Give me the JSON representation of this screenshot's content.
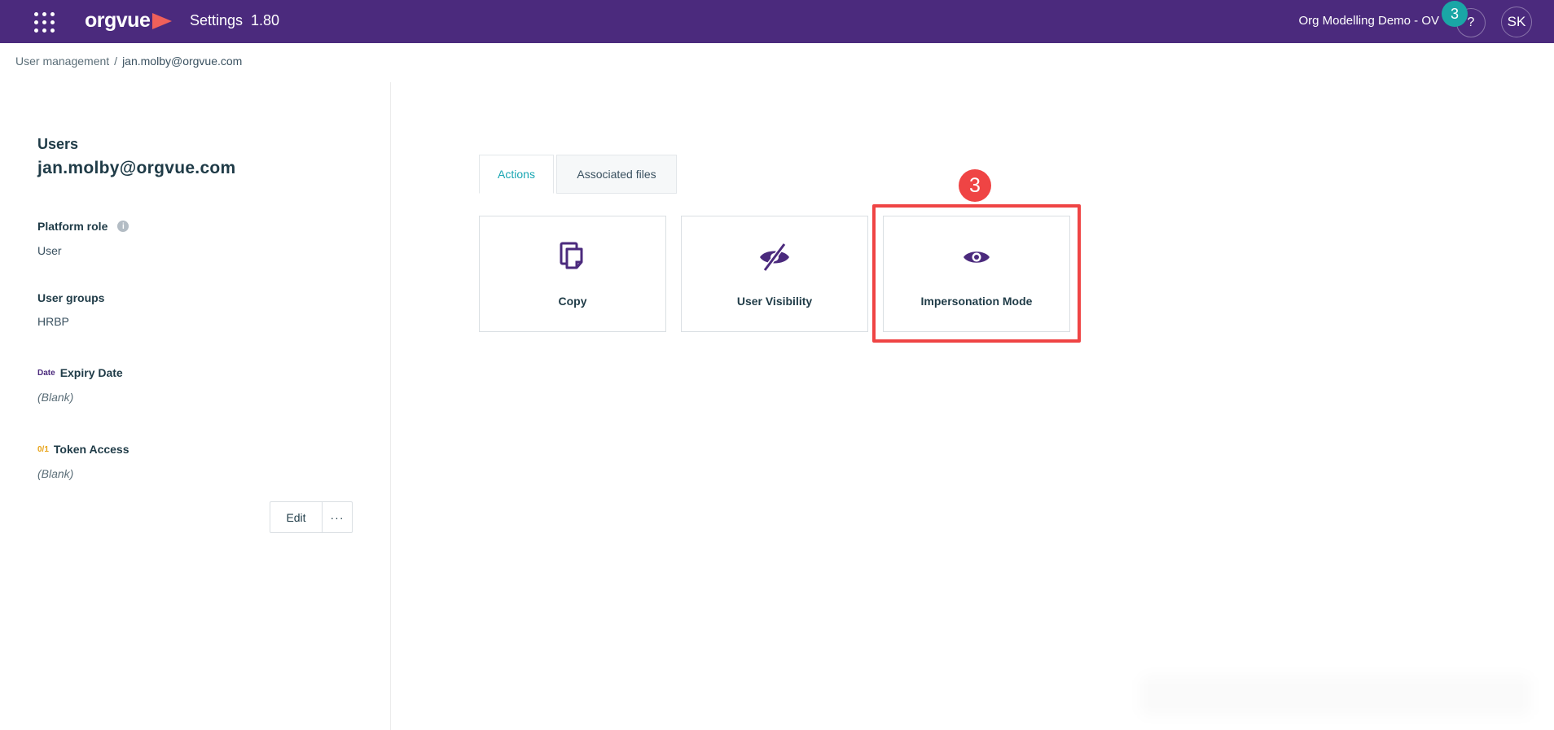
{
  "topbar": {
    "app_name": "Settings",
    "app_version": "1.80",
    "logo_text": "orgvue",
    "org_name": "Org Modelling Demo - OV",
    "help_label": "?",
    "help_badge": "3",
    "avatar_initials": "SK"
  },
  "breadcrumb": {
    "parent": "User management",
    "separator": "/",
    "current": "jan.molby@orgvue.com"
  },
  "user": {
    "heading": "Users",
    "email": "jan.molby@orgvue.com",
    "fields": [
      {
        "label": "Platform role",
        "value": "User"
      },
      {
        "label": "User groups",
        "value": "HRBP"
      },
      {
        "type_tag": "Date",
        "label": "Expiry Date",
        "value": "(Blank)"
      },
      {
        "type_tag": "0/1",
        "label": "Token Access",
        "value": "(Blank)"
      }
    ],
    "info_icon": "i",
    "edit_label": "Edit",
    "more_label": "···"
  },
  "tabs": [
    {
      "label": "Actions",
      "active": true
    },
    {
      "label": "Associated files",
      "active": false
    }
  ],
  "actions": [
    {
      "label": "Copy",
      "icon": "copy-icon"
    },
    {
      "label": "User Visibility",
      "icon": "eye-slash-icon"
    },
    {
      "label": "Impersonation Mode",
      "icon": "eye-icon"
    }
  ],
  "annotation": {
    "step": "3",
    "color": "#ef4444"
  },
  "colors": {
    "brand": "#4b2a7d",
    "accent": "#1aa6b3",
    "logo_mark": "#f0605a"
  }
}
